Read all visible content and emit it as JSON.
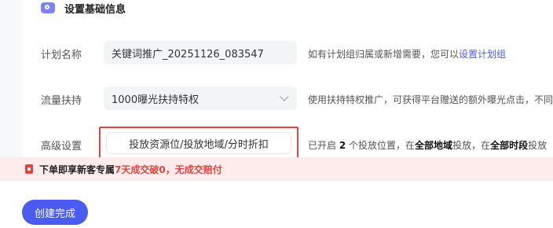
{
  "section": {
    "title": "设置基础信息",
    "icon": "settings-card-icon"
  },
  "plan_name": {
    "label": "计划名称",
    "value": "关键词推广_20251126_083547",
    "hint_prefix": "如有计划组归属或新增需要，您可以",
    "hint_link": "设置计划组"
  },
  "traffic": {
    "label": "流量扶持",
    "selected": "1000曝光扶持特权",
    "hint": "使用扶持特权推广，可获得平台赠送的额外曝光点击，不同"
  },
  "advanced": {
    "label": "高级设置",
    "button": "投放资源位/投放地域/分时折扣",
    "hint_1": "已开启",
    "hint_count": "2",
    "hint_2": "个投放位置，在",
    "hint_region": "全部地域",
    "hint_3": "投放，在",
    "hint_time": "全部时段",
    "hint_4": "投放"
  },
  "promo": {
    "text": "下单即享新客专属",
    "highlight": "7天成交破0，无成交赔付"
  },
  "create_button": "创建完成",
  "colors": {
    "accent": "#4a5cf0",
    "alert": "#e0443e",
    "promo_bg": "#fdeceb"
  }
}
